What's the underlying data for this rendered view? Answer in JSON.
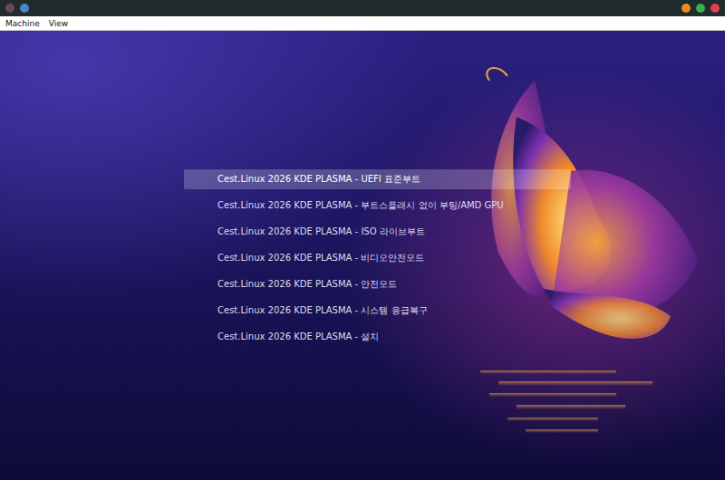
{
  "window": {
    "menubar": [
      "Machine",
      "View"
    ]
  },
  "boot_menu": {
    "items": [
      {
        "label": "Cest.Linux 2026 KDE PLASMA - UEFI 표준부트",
        "selected": true
      },
      {
        "label": "Cest.Linux 2026 KDE PLASMA - 부트스플래시 없이 부팅/AMD GPU",
        "selected": false
      },
      {
        "label": "Cest.Linux 2026 KDE PLASMA - ISO 라이브부트",
        "selected": false
      },
      {
        "label": "Cest.Linux 2026 KDE PLASMA - 비디오안전모드",
        "selected": false
      },
      {
        "label": "Cest.Linux 2026 KDE PLASMA - 안전모드",
        "selected": false
      },
      {
        "label": "Cest.Linux 2026 KDE PLASMA - 시스템 응급복구",
        "selected": false
      },
      {
        "label": "Cest.Linux 2026 KDE PLASMA - 설치",
        "selected": false
      }
    ]
  }
}
